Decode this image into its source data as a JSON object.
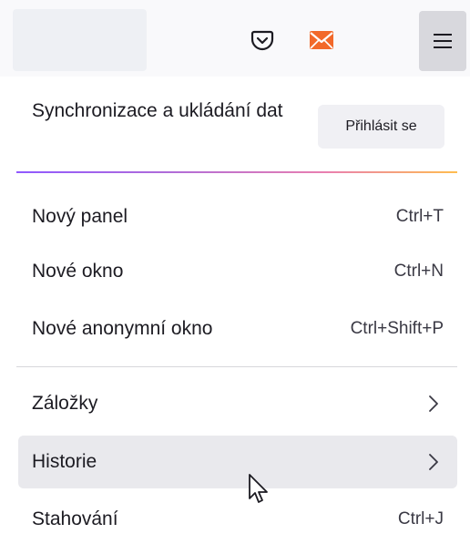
{
  "toolbar": {
    "icons": [
      "pocket-icon",
      "mail-icon",
      "hamburger-menu-icon"
    ],
    "accent_mail": "#f2692a"
  },
  "menu": {
    "sync": {
      "text": "Synchronizace a ukládání dat",
      "button_label": "Přihlásit se"
    },
    "items": [
      {
        "label": "Nový panel",
        "shortcut": "Ctrl+T"
      },
      {
        "label": "Nové okno",
        "shortcut": "Ctrl+N"
      },
      {
        "label": "Nové anonymní okno",
        "shortcut": "Ctrl+Shift+P"
      },
      {
        "label": "Záložky",
        "submenu": true
      },
      {
        "label": "Historie",
        "submenu": true,
        "hovered": true
      },
      {
        "label": "Stahování",
        "shortcut": "Ctrl+J"
      }
    ]
  },
  "colors": {
    "hover_bg": "#e9e9ed",
    "text": "#1c1b22",
    "separator_gradient": [
      "#9059ff",
      "#e97fb0",
      "#ffbd4f"
    ]
  }
}
